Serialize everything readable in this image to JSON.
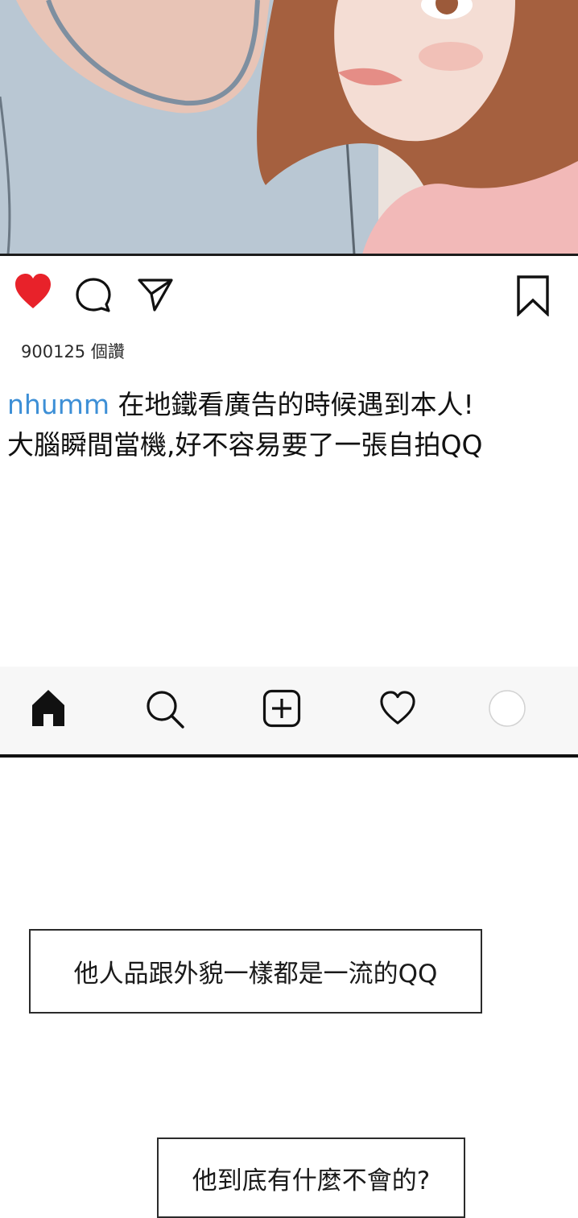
{
  "post": {
    "likes_text": "900125 個讚",
    "username": "nhumm",
    "caption_line1": "在地鐵看廣告的時候遇到本人!",
    "caption_line2": "大腦瞬間當機,好不容易要了一張自拍QQ"
  },
  "action_icons": [
    "heart-filled-icon",
    "comment-icon",
    "share-icon",
    "bookmark-icon"
  ],
  "tab_bar": {
    "items": [
      "home-icon",
      "search-icon",
      "add-post-icon",
      "activity-heart-icon",
      "profile-avatar"
    ]
  },
  "speech_bubbles": [
    "他人品跟外貌一樣都是一流的QQ",
    "他到底有什麼不會的?"
  ],
  "colors": {
    "like_red": "#e8222a",
    "username_blue": "#3d8fd6",
    "tabbar_bg": "#f7f7f7"
  }
}
